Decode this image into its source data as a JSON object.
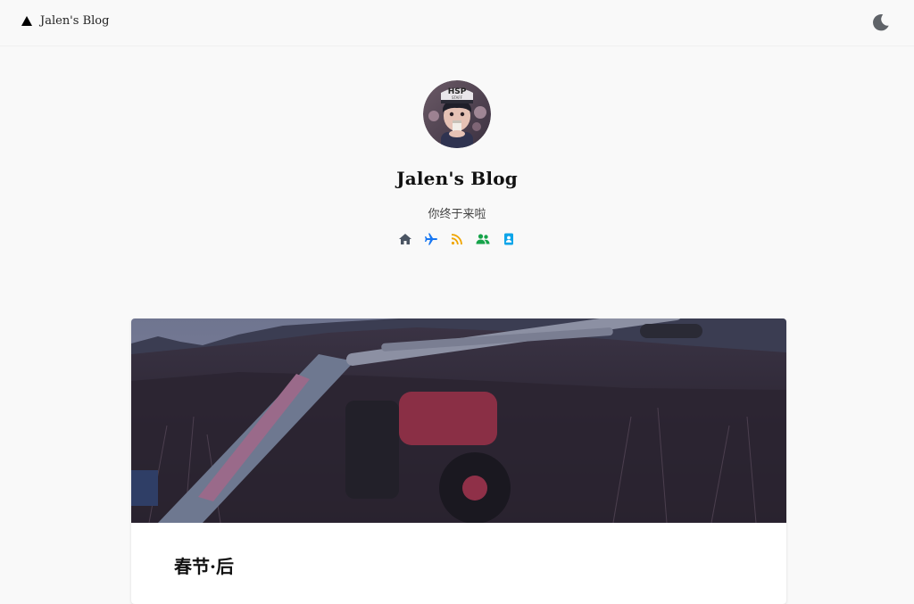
{
  "nav": {
    "brand": "Jalen's Blog",
    "brand_icon": "triangle-logo-icon",
    "theme_toggle_icon": "moon-icon"
  },
  "hero": {
    "title": "Jalen's Blog",
    "subtitle": "你终于来啦",
    "avatar_icon": "avatar-image",
    "social_links": [
      {
        "icon": "home-icon",
        "color": "#4b5563"
      },
      {
        "icon": "plane-icon",
        "color": "#1877f2"
      },
      {
        "icon": "rss-icon",
        "color": "#f0a500"
      },
      {
        "icon": "users-icon",
        "color": "#16a34a"
      },
      {
        "icon": "contact-card-icon",
        "color": "#0ea5e9"
      }
    ]
  },
  "posts": [
    {
      "title": "春节·后",
      "cover_icon": "tiller-in-field-photo"
    }
  ]
}
